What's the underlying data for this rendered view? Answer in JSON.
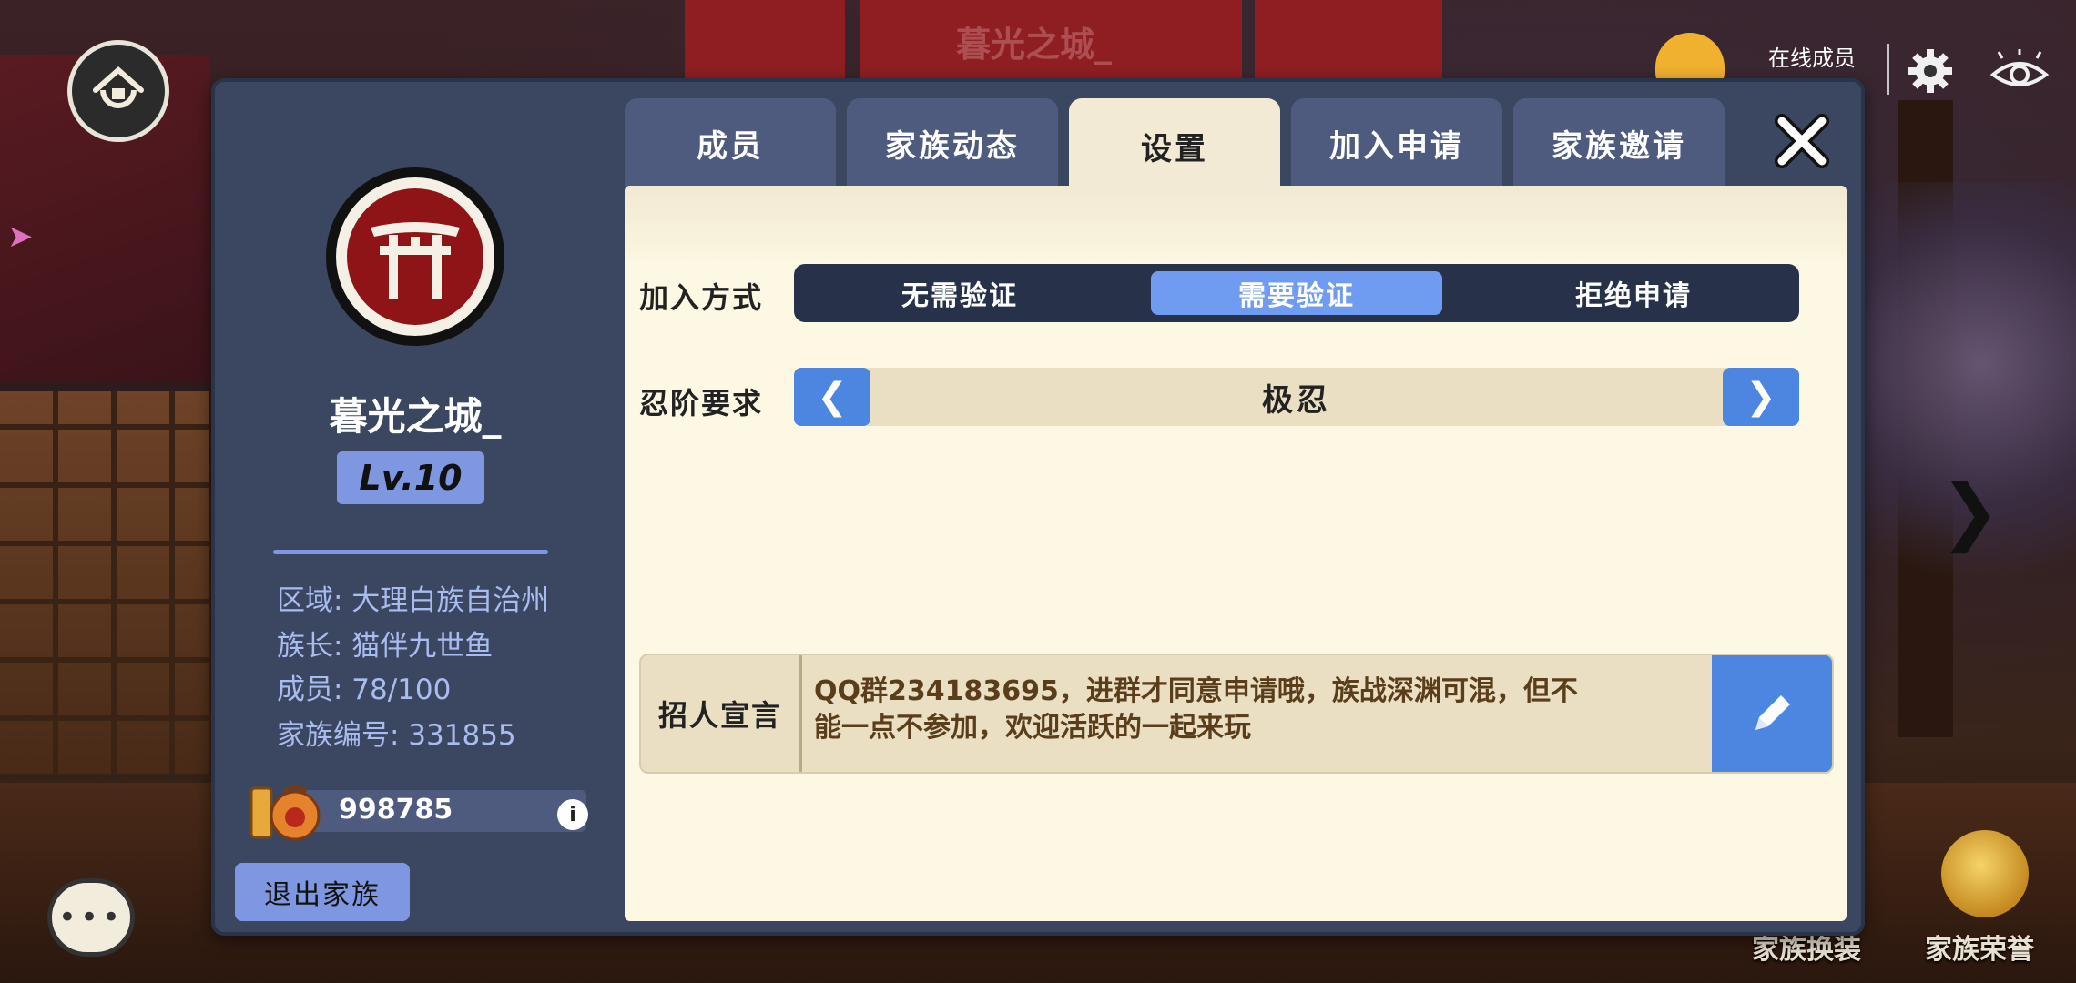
{
  "background": {
    "banner_title": "暮光之城_"
  },
  "hud": {
    "online_label": "在线成员",
    "bottom_items": [
      {
        "label": "家族换装"
      },
      {
        "label": "家族荣誉"
      }
    ]
  },
  "sidebar": {
    "family_name": "暮光之城_",
    "level": "Lv.10",
    "region": "区域: 大理白族自治州",
    "leader": "族长: 猫伴九世鱼",
    "members": "成员: 78/100",
    "family_id": "家族编号: 331855",
    "funds": "998785",
    "leave_button": "退出家族"
  },
  "tabs": [
    {
      "label": "成员"
    },
    {
      "label": "家族动态"
    },
    {
      "label": "设置",
      "active": true
    },
    {
      "label": "加入申请"
    },
    {
      "label": "家族邀请"
    }
  ],
  "settings": {
    "join_method_label": "加入方式",
    "join_options": [
      {
        "label": "无需验证"
      },
      {
        "label": "需要验证",
        "selected": true
      },
      {
        "label": "拒绝申请"
      }
    ],
    "rank_label": "忍阶要求",
    "rank_value": "极忍",
    "recruit_label": "招人宣言",
    "recruit_text_line1": "QQ群234183695，进群才同意申请哦，族战深渊可混，但不",
    "recruit_text_line2": "能一点不参加，欢迎活跃的一起来玩"
  },
  "colors": {
    "panel": "#3b4660",
    "accent_blue": "#4d86e0",
    "selected_option": "#6f9cf0",
    "content_bg": "#fcf8e4",
    "emblem_red": "#8e1418"
  },
  "icons": {
    "home": "home-icon",
    "chat": "chat-bubble-icon",
    "settings": "gear-icon",
    "view": "eye-icon",
    "close": "close-icon",
    "edit": "pencil-icon",
    "funds": "coin-bag-icon",
    "info": "info-icon"
  }
}
